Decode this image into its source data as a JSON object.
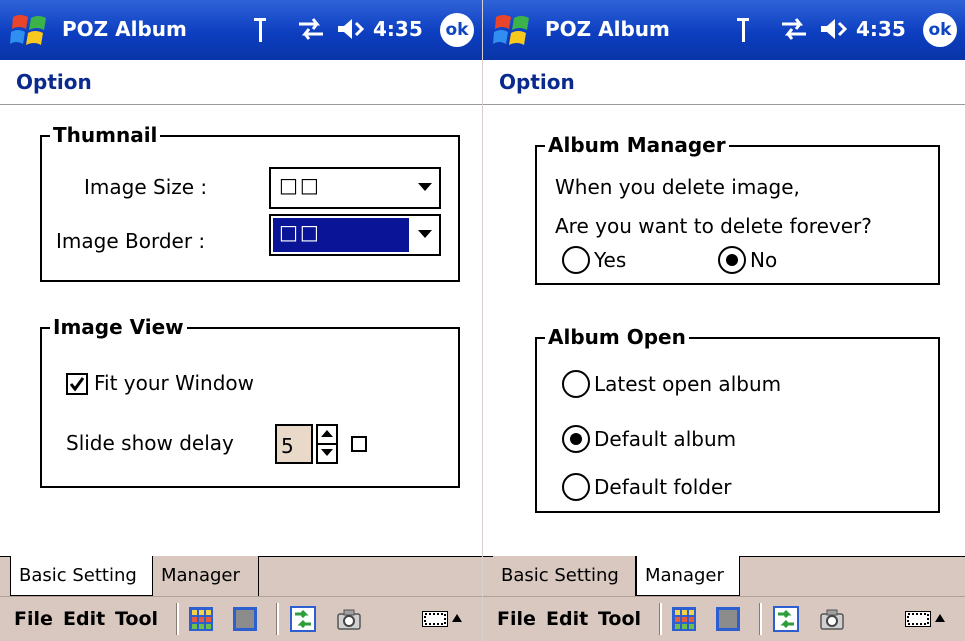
{
  "screens": [
    {
      "app_title": "POZ Album",
      "clock": "4:35",
      "ok_label": "ok",
      "page_title": "Option",
      "thumbnail": {
        "title": "Thumnail",
        "image_size_label": "Image Size :",
        "image_size_value": "□□",
        "image_border_label": "Image Border :",
        "image_border_value": "□□"
      },
      "image_view": {
        "title": "Image View",
        "fit_window_label": "Fit your Window",
        "fit_window_checked": true,
        "slide_delay_label": "Slide show delay",
        "slide_delay_value": "5"
      },
      "tabs": [
        {
          "label": "Basic Setting",
          "active": true
        },
        {
          "label": "Manager",
          "active": false
        }
      ],
      "menu": {
        "file": "File",
        "edit": "Edit",
        "tool": "Tool"
      }
    },
    {
      "app_title": "POZ Album",
      "clock": "4:35",
      "ok_label": "ok",
      "page_title": "Option",
      "album_manager": {
        "title": "Album Manager",
        "line1": "When you delete image,",
        "line2": "Are you want to delete forever?",
        "yes_label": "Yes",
        "no_label": "No",
        "selected": "No"
      },
      "album_open": {
        "title": "Album Open",
        "options": [
          "Latest open album",
          "Default album",
          "Default folder"
        ],
        "selected": "Default album"
      },
      "tabs": [
        {
          "label": "Basic Setting",
          "active": false
        },
        {
          "label": "Manager",
          "active": true
        }
      ],
      "menu": {
        "file": "File",
        "edit": "Edit",
        "tool": "Tool"
      }
    }
  ],
  "colors": {
    "title_bar": "#0c3ec0",
    "heading_text": "#0b2a8e",
    "selection": "#0a1496",
    "tab_background": "#d8c8bf"
  }
}
